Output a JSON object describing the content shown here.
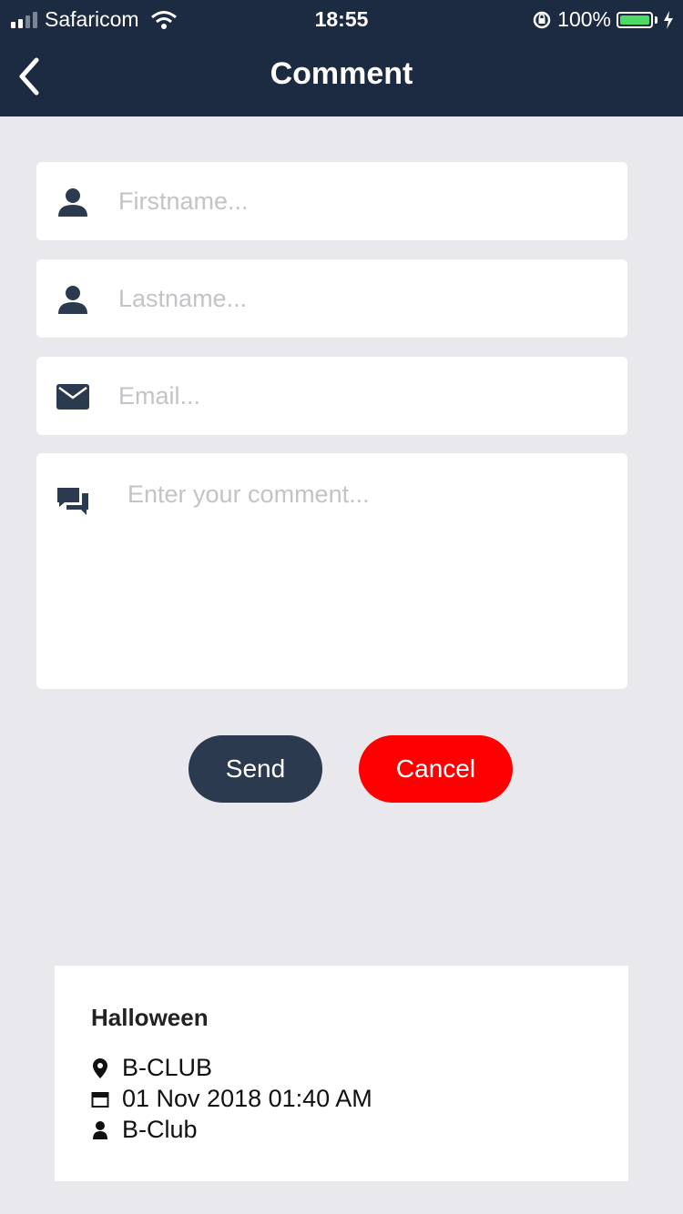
{
  "status_bar": {
    "carrier": "Safaricom",
    "time": "18:55",
    "battery": "100%",
    "battery_level": 1.0
  },
  "header": {
    "title": "Comment",
    "back_icon": "chevron-left-icon"
  },
  "form": {
    "firstname": {
      "placeholder": "Firstname...",
      "icon": "person-icon"
    },
    "lastname": {
      "placeholder": "Lastname...",
      "icon": "person-icon"
    },
    "email": {
      "placeholder": "Email...",
      "icon": "mail-icon"
    },
    "comment": {
      "placeholder": "Enter your comment...",
      "icon": "chat-icon"
    }
  },
  "buttons": {
    "send": "Send",
    "cancel": "Cancel"
  },
  "event": {
    "title": "Halloween",
    "venue": "B-CLUB",
    "datetime": "01 Nov 2018 01:40 AM",
    "organizer": "B-Club"
  },
  "colors": {
    "header_bg": "#1c2b42",
    "send_bg": "#2b3a4e",
    "cancel_bg": "#ff0000",
    "page_bg": "#e9e8ed"
  }
}
